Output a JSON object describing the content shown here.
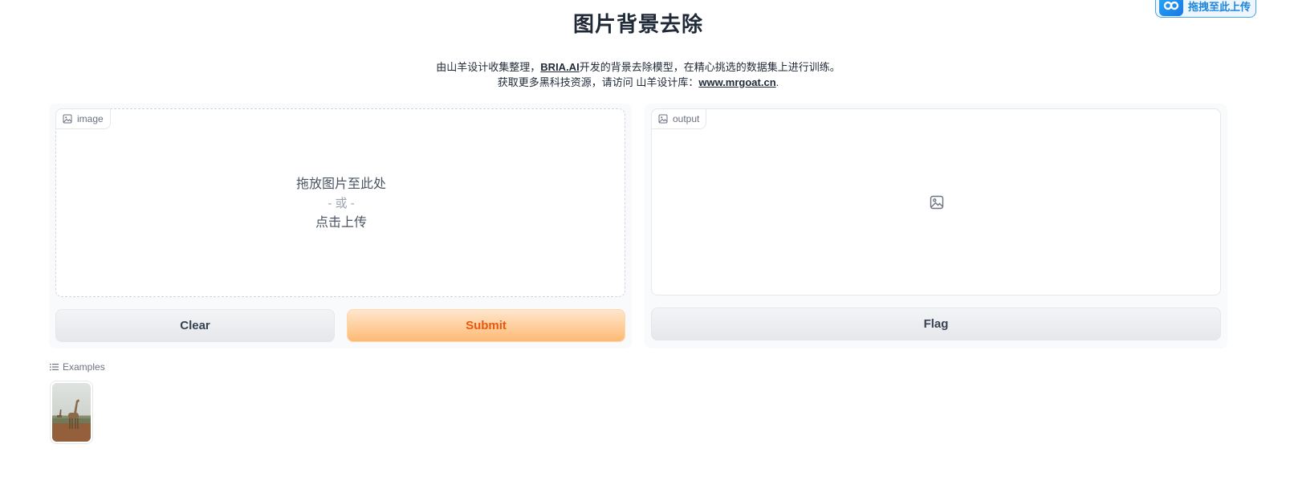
{
  "floating_upload": {
    "label": "拖拽至此上传"
  },
  "header": {
    "title": "图片背景去除",
    "desc_line1_pre": "由山羊设计收集整理，",
    "desc_line1_link": "BRIA.AI",
    "desc_line1_post": "开发的背景去除模型，在精心挑选的数据集上进行训练。",
    "desc_line2_pre": "获取更多黑科技资源，请访问 山羊设计库：",
    "desc_line2_link": "www.mrgoat.cn",
    "desc_line2_post": "."
  },
  "input_panel": {
    "tag_label": "image",
    "drop_line1": "拖放图片至此处",
    "drop_or": "- 或 -",
    "drop_line2": "点击上传",
    "clear_label": "Clear",
    "submit_label": "Submit"
  },
  "output_panel": {
    "tag_label": "output",
    "flag_label": "Flag"
  },
  "examples": {
    "label": "Examples",
    "items": [
      {
        "icon": "giraffe-thumbnail"
      }
    ]
  },
  "colors": {
    "accent_orange": "#ea580c",
    "submit_bg": "#fdba74",
    "badge_blue": "#1d86dc"
  }
}
